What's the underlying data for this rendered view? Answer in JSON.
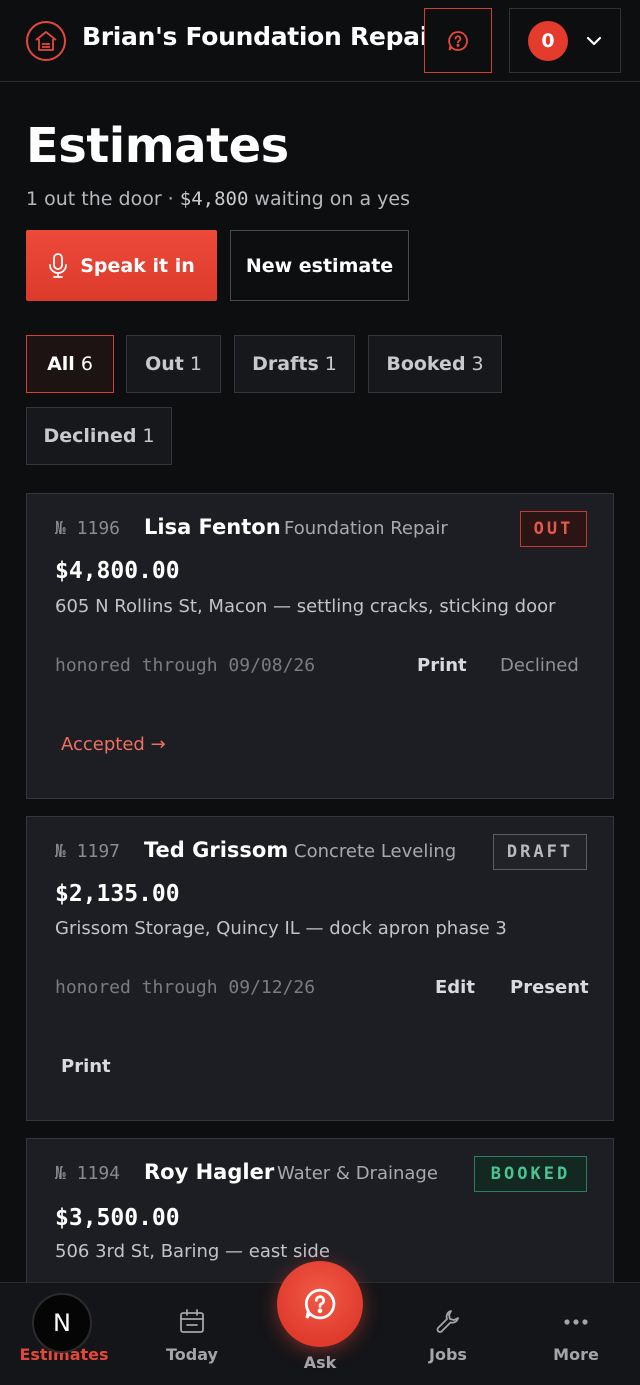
{
  "header": {
    "brand_name": "Brian's Foundation Repair",
    "notifications_count": "0"
  },
  "page": {
    "title": "Estimates",
    "subtitle_pre": "1 out the door · ",
    "subtitle_amount": "$4,800",
    "subtitle_post": " waiting on a yes",
    "speak_label": "Speak it in",
    "new_label": "New estimate"
  },
  "filters": [
    {
      "label": "All",
      "count": "6"
    },
    {
      "label": "Out",
      "count": "1"
    },
    {
      "label": "Drafts",
      "count": "1"
    },
    {
      "label": "Booked",
      "count": "3"
    },
    {
      "label": "Declined",
      "count": "1"
    }
  ],
  "estimates": [
    {
      "number": "№ 1196",
      "customer": "Lisa Fenton",
      "service": "Foundation Repair",
      "status": "OUT",
      "amount": "$4,800.00",
      "address": "605 N Rollins St, Macon — settling cracks, sticking door",
      "honored": "honored through 09/08/26",
      "actions": [
        "Print",
        "Declined",
        "Accepted →"
      ]
    },
    {
      "number": "№ 1197",
      "customer": "Ted Grissom",
      "service": "Concrete Leveling",
      "status": "DRAFT",
      "amount": "$2,135.00",
      "address": "Grissom Storage, Quincy IL — dock apron phase 3",
      "honored": "honored through 09/12/26",
      "actions": [
        "Edit",
        "Present",
        "Print"
      ]
    },
    {
      "number": "№ 1194",
      "customer": "Roy Hagler",
      "service": "Water & Drainage",
      "status": "BOOKED",
      "amount": "$3,500.00",
      "address": "506 3rd St, Baring — east side"
    }
  ],
  "nav": {
    "estimates": "Estimates",
    "today": "Today",
    "ask": "Ask",
    "jobs": "Jobs",
    "more": "More",
    "profile_initial": "N"
  },
  "colors": {
    "accent": "#e5483b",
    "background": "#0d0e10",
    "card": "#1d1e23",
    "booked": "#49c593"
  }
}
